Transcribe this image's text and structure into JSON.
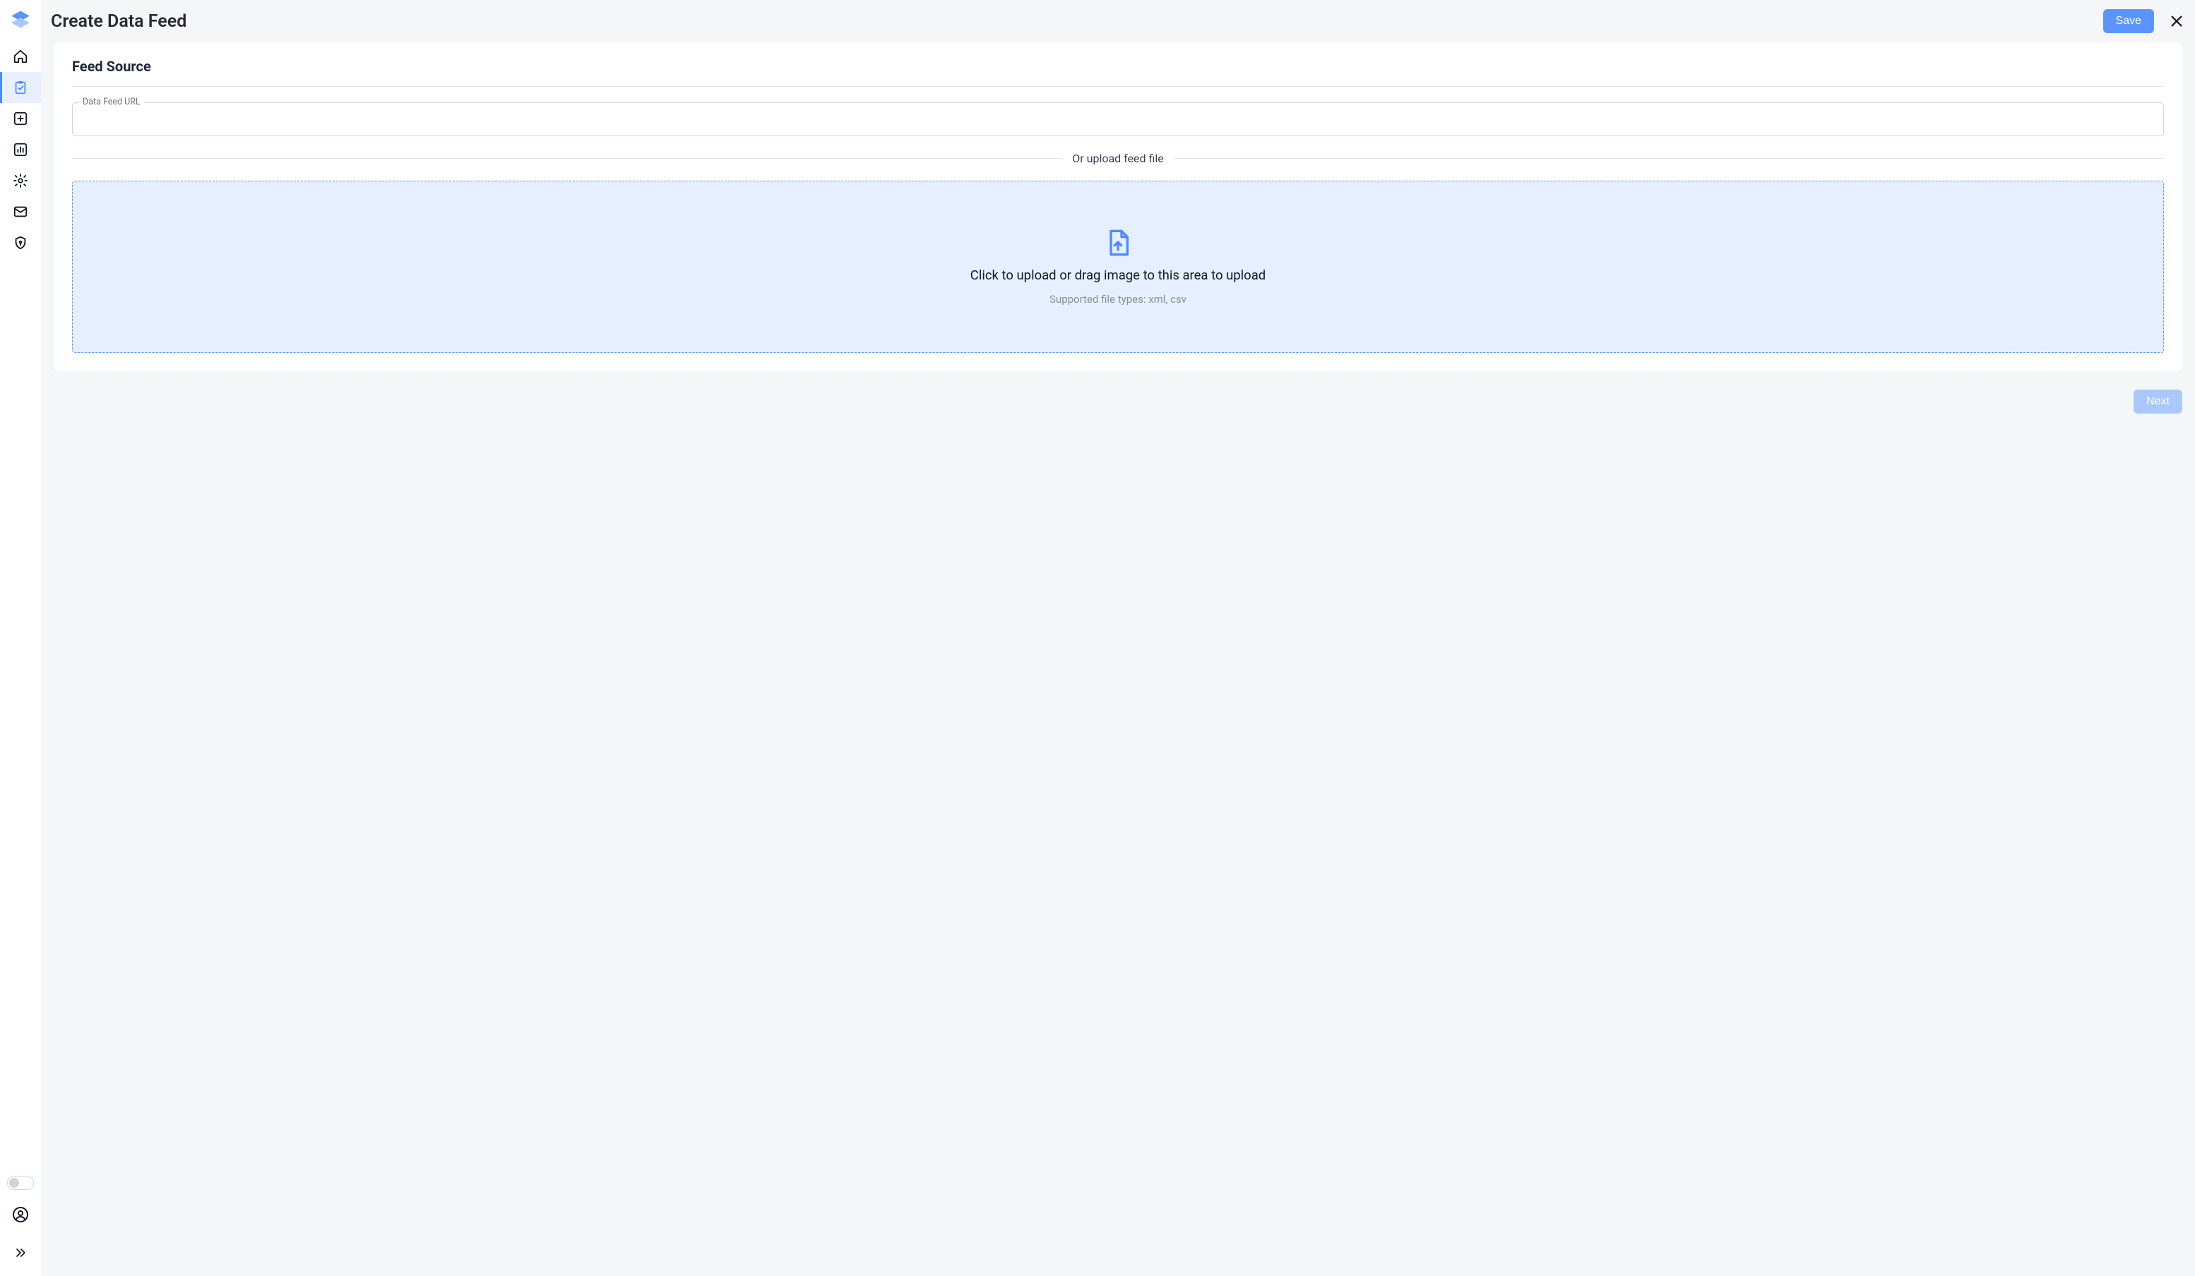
{
  "header": {
    "title": "Create Data Feed",
    "save_label": "Save"
  },
  "sidebar": {
    "items": [
      {
        "id": "home",
        "icon": "home-icon"
      },
      {
        "id": "feeds",
        "icon": "clipboard-check-icon",
        "active": true
      },
      {
        "id": "add",
        "icon": "plus-square-icon"
      },
      {
        "id": "reports",
        "icon": "bar-chart-icon"
      },
      {
        "id": "settings",
        "icon": "gear-icon"
      },
      {
        "id": "mail",
        "icon": "mail-icon"
      },
      {
        "id": "security",
        "icon": "shield-key-icon"
      }
    ]
  },
  "card": {
    "title": "Feed Source",
    "url_field": {
      "label": "Data Feed URL",
      "value": ""
    },
    "divider_text": "Or upload feed file",
    "dropzone": {
      "title": "Click to upload or drag image to this area to upload",
      "subtitle": "Supported file types: xml, csv"
    }
  },
  "footer": {
    "next_label": "Next",
    "next_enabled": false
  }
}
